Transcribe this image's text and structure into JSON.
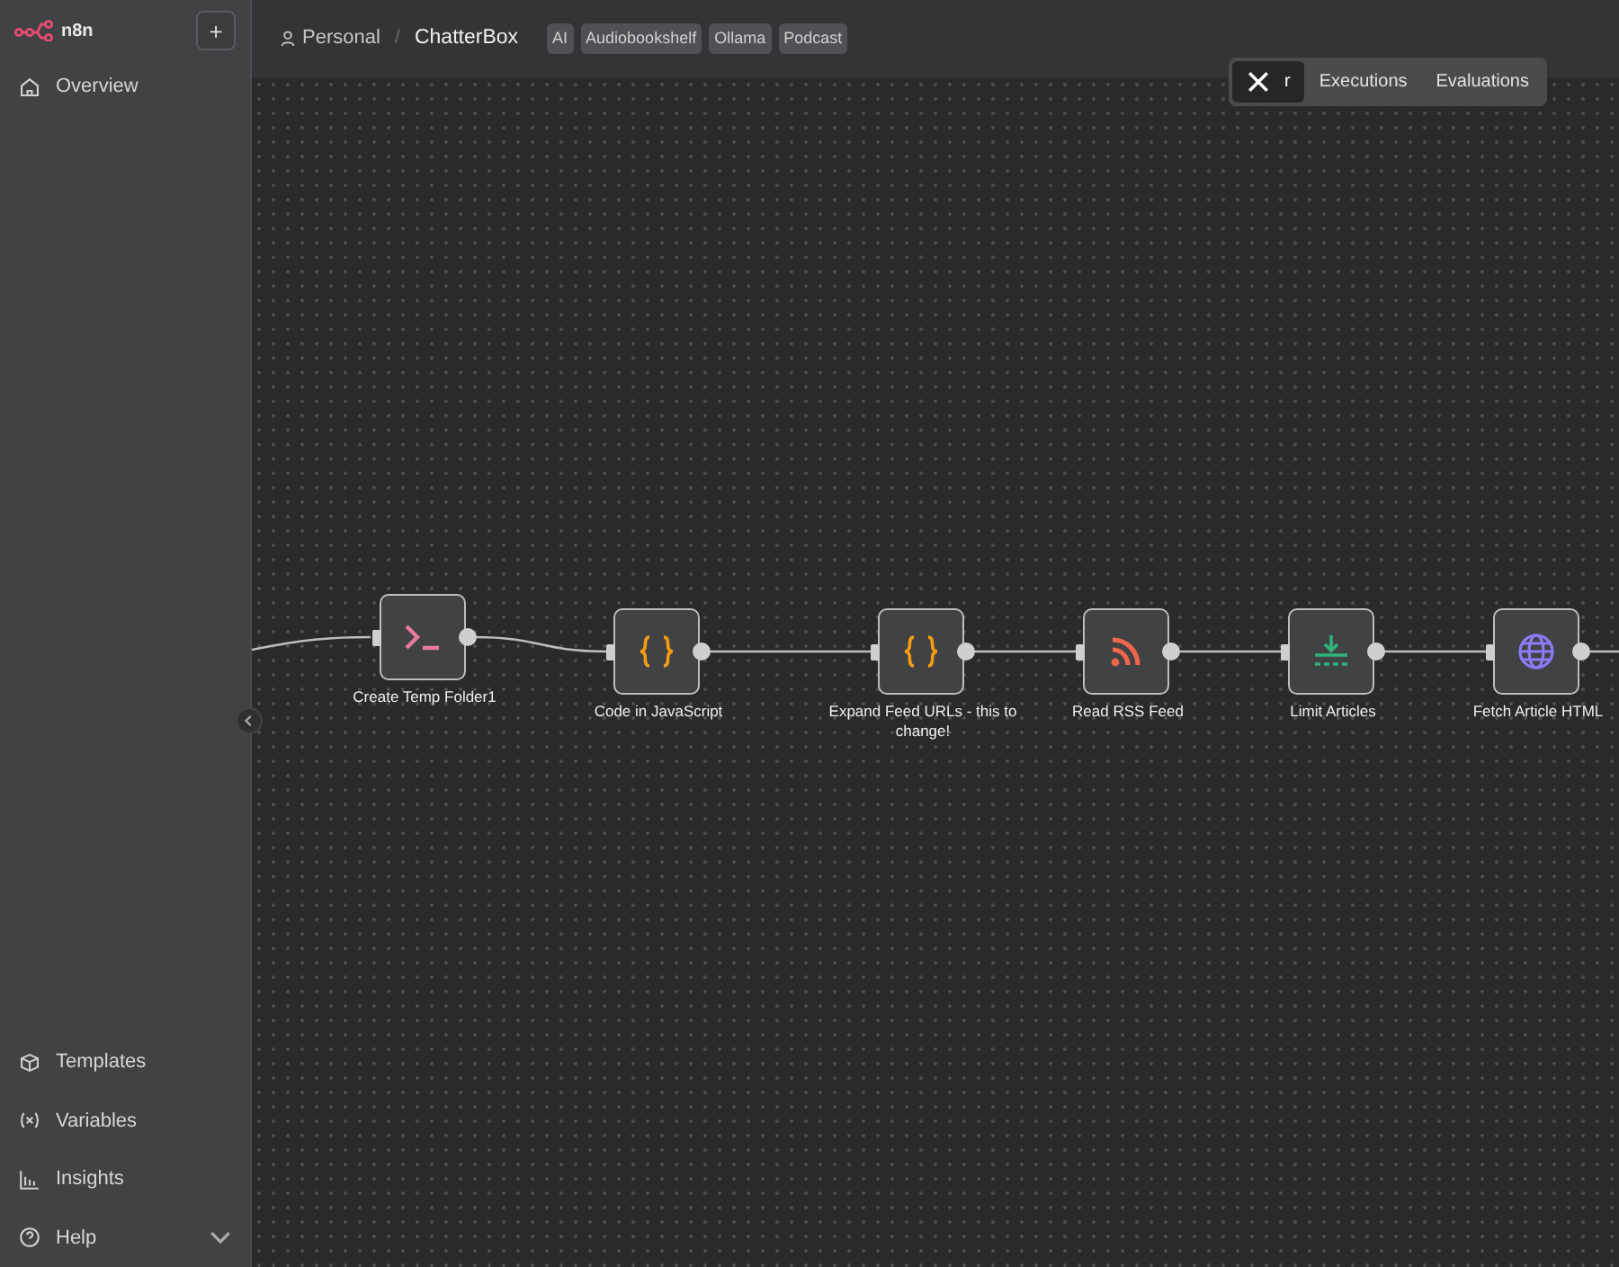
{
  "sidebar": {
    "logo": "n8n",
    "add_button": "+",
    "items": [
      {
        "label": "Overview"
      }
    ],
    "bottom_items": [
      {
        "label": "Templates"
      },
      {
        "label": "Variables"
      },
      {
        "label": "Insights"
      },
      {
        "label": "Help",
        "expanded": false
      }
    ]
  },
  "header": {
    "owner": "Personal",
    "separator": "/",
    "workflow": "ChatterBox",
    "tags": [
      "AI",
      "Audiobookshelf",
      "Ollama",
      "Podcast"
    ]
  },
  "tabs": [
    {
      "label": "r",
      "selected": true
    },
    {
      "label": "Executions",
      "selected": false
    },
    {
      "label": "Evaluations",
      "selected": false
    }
  ],
  "nodes": [
    {
      "label": "Create Temp Folder1",
      "kind": "command"
    },
    {
      "label": "Code in JavaScript",
      "kind": "code"
    },
    {
      "label": "Expand Feed URLs - this to change!",
      "kind": "code"
    },
    {
      "label": "Read RSS Feed",
      "kind": "rss"
    },
    {
      "label": "Limit Articles",
      "kind": "limit"
    },
    {
      "label": "Fetch Article HTML",
      "kind": "http"
    }
  ]
}
